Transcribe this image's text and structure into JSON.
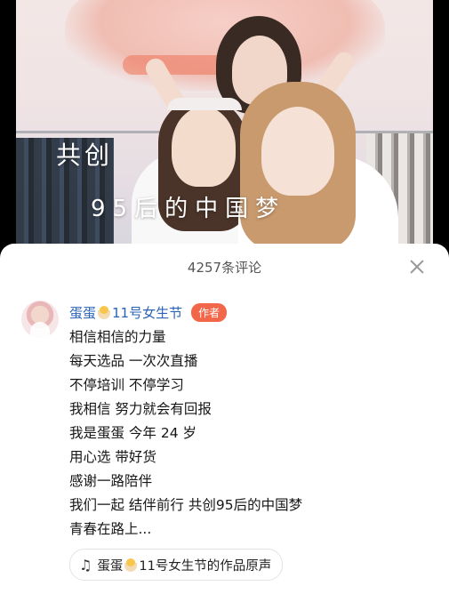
{
  "video": {
    "overlay_line1": "共创",
    "overlay_line2": "95后的中国梦"
  },
  "comments_header": {
    "count_text": "4257条评论"
  },
  "author_comment": {
    "name_prefix": "蛋蛋",
    "name_suffix": "11号女生节",
    "badge": "作者",
    "lines": [
      "相信相信的力量",
      "每天选品  一次次直播",
      "不停培训  不停学习",
      "我相信  努力就会有回报",
      "我是蛋蛋  今年 24 岁",
      "用心选  带好货",
      "感谢一路陪伴",
      "我们一起 结伴前行  共创95后的中国梦",
      "青春在路上..."
    ]
  },
  "sound": {
    "prefix": "蛋蛋",
    "suffix": "11号女生节的作品原声"
  },
  "icons": {
    "close": "close-icon",
    "chick": "chick-emoji-icon",
    "music": "music-note-icon"
  },
  "colors": {
    "author_name": "#2a63b8",
    "badge_bg": "#f2674a"
  }
}
